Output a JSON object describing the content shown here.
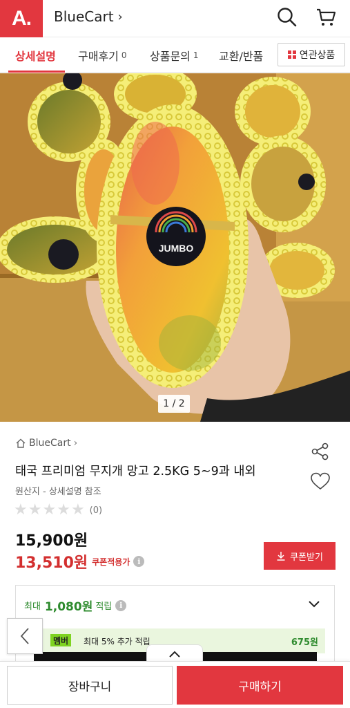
{
  "header": {
    "logo_text": "A.",
    "store_name": "BlueCart",
    "icons": [
      "search-icon",
      "cart-icon"
    ]
  },
  "tabs": [
    {
      "label": "상세설명",
      "count": ""
    },
    {
      "label": "구매후기",
      "count": "0"
    },
    {
      "label": "상품문의",
      "count": "1"
    },
    {
      "label": "교환/반품",
      "count": ""
    }
  ],
  "related_button": "연관상품",
  "gallery": {
    "counter": "1 / 2",
    "sticker_text": "JUMBO"
  },
  "product": {
    "store": "BlueCart",
    "title": "태국 프리미엄 무지개 망고 2.5KG 5~9과 내외",
    "origin": "원산지 - 상세설명 참조",
    "review_count": "(0)",
    "price_original": "15,900원",
    "price_sale": "13,510원",
    "price_sale_label": "쿠폰적용가",
    "coupon_button": "쿠폰받기"
  },
  "points": {
    "prefix": "최대",
    "amount": "1,080원",
    "suffix": "적립",
    "member_badge": "멤버",
    "member_text": "최대 5% 추가 적립",
    "member_amount": "675원"
  },
  "bottom": {
    "cart_label": "장바구니",
    "buy_label": "구매하기"
  },
  "colors": {
    "brand": "#e2373f",
    "points_green": "#2e8b2e"
  }
}
